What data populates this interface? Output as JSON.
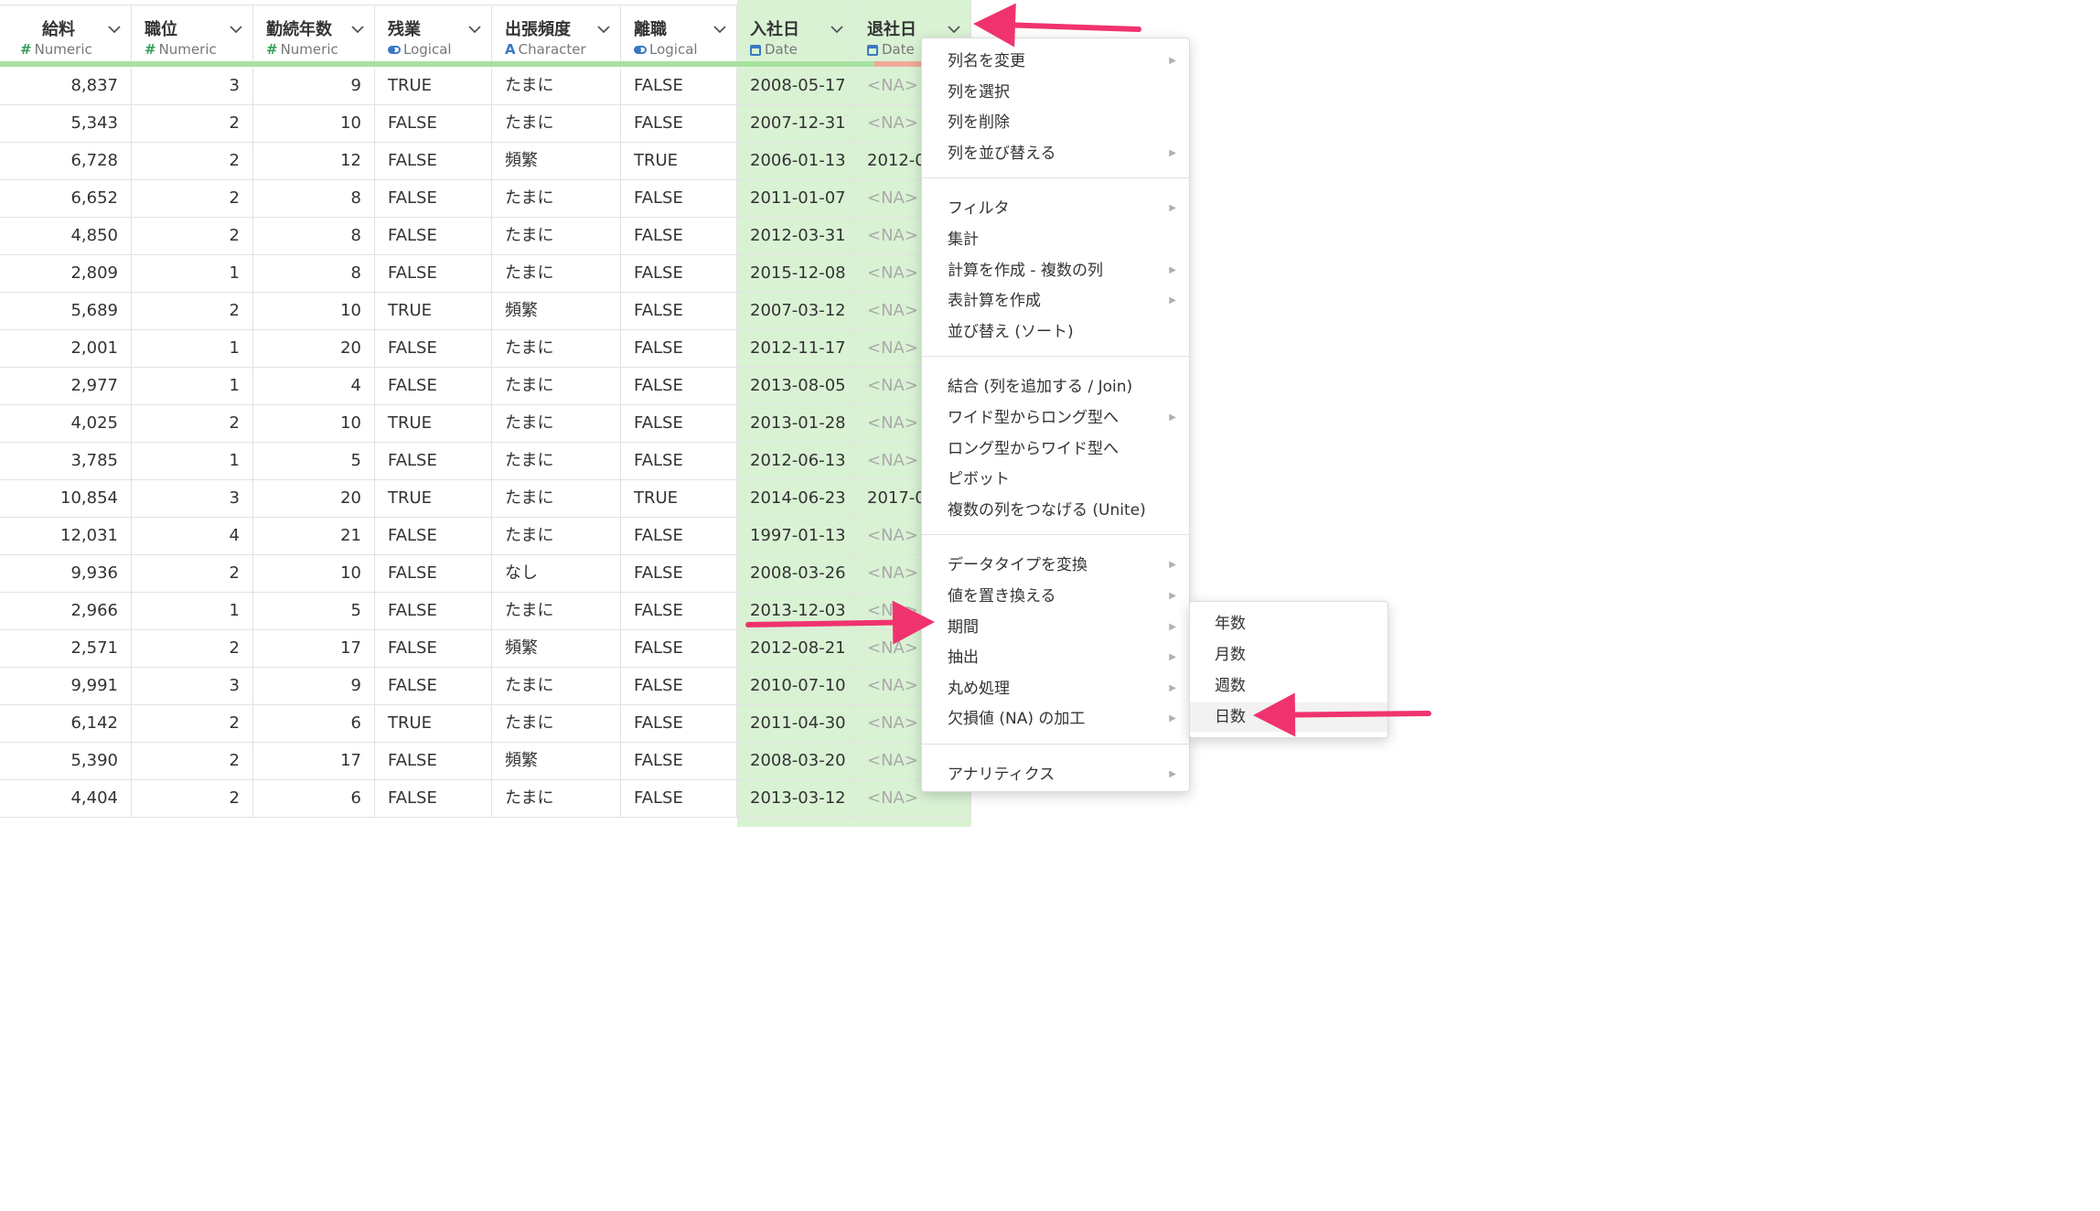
{
  "columns": [
    {
      "name": "給料",
      "type": "Numeric",
      "type_icon": "numeric-icon",
      "align": "r"
    },
    {
      "name": "職位",
      "type": "Numeric",
      "type_icon": "numeric-icon",
      "align": "r"
    },
    {
      "name": "勤続年数",
      "type": "Numeric",
      "type_icon": "numeric-icon",
      "align": "r"
    },
    {
      "name": "残業",
      "type": "Logical",
      "type_icon": "logical-icon",
      "align": "l"
    },
    {
      "name": "出張頻度",
      "type": "Character",
      "type_icon": "character-icon",
      "align": "l"
    },
    {
      "name": "離職",
      "type": "Logical",
      "type_icon": "logical-icon",
      "align": "l"
    },
    {
      "name": "入社日",
      "type": "Date",
      "type_icon": "date-icon",
      "align": "l"
    },
    {
      "name": "退社日",
      "type": "Date",
      "type_icon": "date-icon",
      "align": "l"
    }
  ],
  "rows": [
    [
      "8,837",
      "3",
      "9",
      "TRUE",
      "たまに",
      "FALSE",
      "2008-05-17",
      "<NA>"
    ],
    [
      "5,343",
      "2",
      "10",
      "FALSE",
      "たまに",
      "FALSE",
      "2007-12-31",
      "<NA>"
    ],
    [
      "6,728",
      "2",
      "12",
      "FALSE",
      "頻繁",
      "TRUE",
      "2006-01-13",
      "2012-0"
    ],
    [
      "6,652",
      "2",
      "8",
      "FALSE",
      "たまに",
      "FALSE",
      "2011-01-07",
      "<NA>"
    ],
    [
      "4,850",
      "2",
      "8",
      "FALSE",
      "たまに",
      "FALSE",
      "2012-03-31",
      "<NA>"
    ],
    [
      "2,809",
      "1",
      "8",
      "FALSE",
      "たまに",
      "FALSE",
      "2015-12-08",
      "<NA>"
    ],
    [
      "5,689",
      "2",
      "10",
      "TRUE",
      "頻繁",
      "FALSE",
      "2007-03-12",
      "<NA>"
    ],
    [
      "2,001",
      "1",
      "20",
      "FALSE",
      "たまに",
      "FALSE",
      "2012-11-17",
      "<NA>"
    ],
    [
      "2,977",
      "1",
      "4",
      "FALSE",
      "たまに",
      "FALSE",
      "2013-08-05",
      "<NA>"
    ],
    [
      "4,025",
      "2",
      "10",
      "TRUE",
      "たまに",
      "FALSE",
      "2013-01-28",
      "<NA>"
    ],
    [
      "3,785",
      "1",
      "5",
      "FALSE",
      "たまに",
      "FALSE",
      "2012-06-13",
      "<NA>"
    ],
    [
      "10,854",
      "3",
      "20",
      "TRUE",
      "たまに",
      "TRUE",
      "2014-06-23",
      "2017-0"
    ],
    [
      "12,031",
      "4",
      "21",
      "FALSE",
      "たまに",
      "FALSE",
      "1997-01-13",
      "<NA>"
    ],
    [
      "9,936",
      "2",
      "10",
      "FALSE",
      "なし",
      "FALSE",
      "2008-03-26",
      "<NA>"
    ],
    [
      "2,966",
      "1",
      "5",
      "FALSE",
      "たまに",
      "FALSE",
      "2013-12-03",
      "<NA>"
    ],
    [
      "2,571",
      "2",
      "17",
      "FALSE",
      "頻繁",
      "FALSE",
      "2012-08-21",
      "<NA>"
    ],
    [
      "9,991",
      "3",
      "9",
      "FALSE",
      "たまに",
      "FALSE",
      "2010-07-10",
      "<NA>"
    ],
    [
      "6,142",
      "2",
      "6",
      "TRUE",
      "たまに",
      "FALSE",
      "2011-04-30",
      "<NA>"
    ],
    [
      "5,390",
      "2",
      "17",
      "FALSE",
      "頻繁",
      "FALSE",
      "2008-03-20",
      "<NA>"
    ],
    [
      "4,404",
      "2",
      "6",
      "FALSE",
      "たまに",
      "FALSE",
      "2013-03-12",
      "<NA>"
    ]
  ],
  "context_menu": {
    "groups": [
      [
        {
          "label": "列名を変更",
          "submenu": true
        },
        {
          "label": "列を選択",
          "submenu": false
        },
        {
          "label": "列を削除",
          "submenu": false
        },
        {
          "label": "列を並び替える",
          "submenu": true
        }
      ],
      [
        {
          "label": "フィルタ",
          "submenu": true
        },
        {
          "label": "集計",
          "submenu": false
        },
        {
          "label": "計算を作成 - 複数の列",
          "submenu": true
        },
        {
          "label": "表計算を作成",
          "submenu": true
        },
        {
          "label": "並び替え (ソート)",
          "submenu": false
        }
      ],
      [
        {
          "label": "結合 (列を追加する / Join)",
          "submenu": false
        },
        {
          "label": "ワイド型からロング型へ",
          "submenu": true
        },
        {
          "label": "ロング型からワイド型へ",
          "submenu": false
        },
        {
          "label": "ピボット",
          "submenu": false
        },
        {
          "label": "複数の列をつなげる (Unite)",
          "submenu": false
        }
      ],
      [
        {
          "label": "データタイプを変換",
          "submenu": true
        },
        {
          "label": "値を置き換える",
          "submenu": true
        },
        {
          "label": "期間",
          "submenu": true
        },
        {
          "label": "抽出",
          "submenu": true
        },
        {
          "label": "丸め処理",
          "submenu": true
        },
        {
          "label": "欠損値 (NA) の加工",
          "submenu": true
        }
      ],
      [
        {
          "label": "アナリティクス",
          "submenu": true
        }
      ]
    ]
  },
  "submenu": {
    "items": [
      {
        "label": "年数"
      },
      {
        "label": "月数"
      },
      {
        "label": "週数"
      },
      {
        "label": "日数"
      }
    ],
    "highlighted": "日数"
  },
  "colors": {
    "date_column_bg": "#d9f2d4",
    "header_bar": "#a8e2a0",
    "missing_bar": "#f0a89a",
    "arrow": "#f0336e"
  }
}
